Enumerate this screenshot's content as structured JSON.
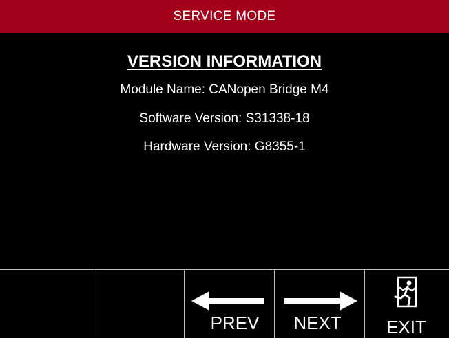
{
  "header": {
    "title": "SERVICE MODE"
  },
  "version_info": {
    "heading": "VERSION INFORMATION",
    "module_name": "Module Name: CANopen Bridge M4",
    "software_version": "Software Version: S31338-18",
    "hardware_version": "Hardware Version: G8355-1"
  },
  "softkeys": {
    "prev_label": "PREV",
    "next_label": "NEXT",
    "exit_label": "EXIT"
  },
  "icons": {
    "prev": "left-arrow-icon",
    "next": "right-arrow-icon",
    "exit": "exit-running-man-icon"
  },
  "colors": {
    "header_bg": "#a3001b",
    "background": "#000000",
    "text": "#ffffff",
    "divider": "#bfbfbf"
  }
}
